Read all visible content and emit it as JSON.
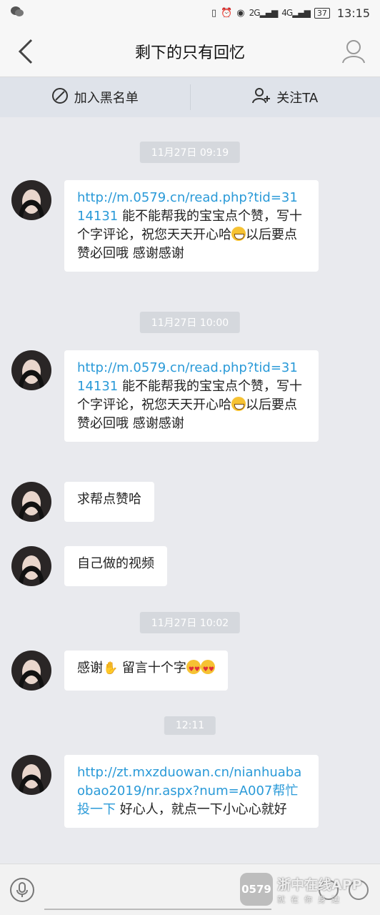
{
  "status_bar": {
    "time": "13:15",
    "battery": "37",
    "net1": "2G",
    "net2": "4G"
  },
  "nav": {
    "title": "剩下的只有回忆"
  },
  "actions": {
    "block": "加入黑名单",
    "follow": "关注TA"
  },
  "messages": {
    "ts1": "11月27日 09:19",
    "m1": {
      "link": "http://m.0579.cn/read.php?tid=3114131",
      "text_a": " 能不能帮我的宝宝点个赞，写十个字评论，祝您天天开心哈",
      "text_b": "以后要点赞必回哦 感谢感谢"
    },
    "ts2": "11月27日 10:00",
    "m2": {
      "link": "http://m.0579.cn/read.php?tid=3114131",
      "text_a": " 能不能帮我的宝宝点个赞，写十个字评论，祝您天天开心哈",
      "text_b": "以后要点赞必回哦 感谢感谢"
    },
    "m3": "求帮点赞哈",
    "m4": "自己做的视频",
    "ts3": "11月27日 10:02",
    "m5": {
      "a": "感谢",
      "b": " 留言十个字"
    },
    "ts4": "12:11",
    "m6": {
      "link": "http://zt.mxzduowan.cn/nianhuabaobao2019/nr.aspx?num=A007帮忙投一下",
      "text": " 好心人，就点一下小心心就好"
    }
  },
  "watermark": {
    "logo": "0579",
    "name": "浙中在线APP",
    "slogan": "就在你身边"
  },
  "colors": {
    "link": "#2a9ad8",
    "background": "#e9eaee",
    "bubble": "#ffffff"
  }
}
